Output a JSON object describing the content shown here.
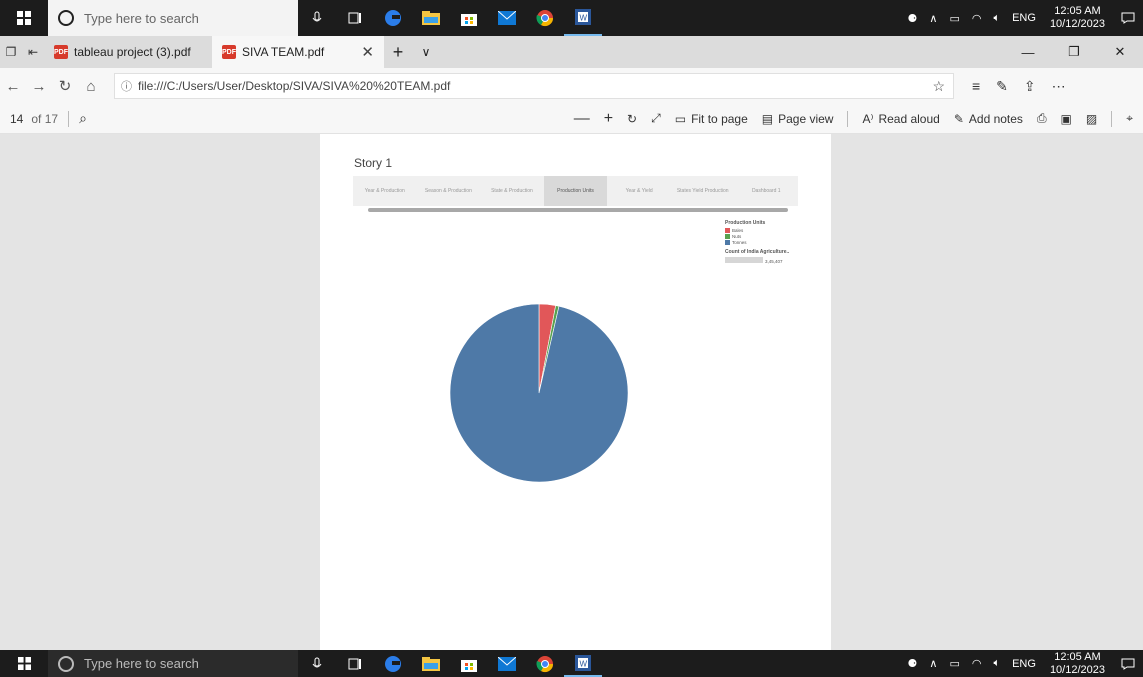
{
  "taskbar": {
    "search_placeholder": "Type here to search",
    "lang": "ENG",
    "time": "12:05 AM",
    "date": "10/12/2023"
  },
  "tabs": [
    {
      "label": "tableau project (3).pdf"
    },
    {
      "label": "SIVA TEAM.pdf"
    }
  ],
  "address": {
    "url": "file:///C:/Users/User/Desktop/SIVA/SIVA%20%20TEAM.pdf"
  },
  "pdf_toolbar": {
    "page_number": "14",
    "page_count": "of 17",
    "fit_to_page": "Fit to page",
    "page_view": "Page view",
    "read_aloud": "Read aloud",
    "add_notes": "Add notes"
  },
  "story": {
    "title": "Story 1",
    "nav_items": [
      "Year & Production",
      "Season & Production",
      "State & Production",
      "Production Units",
      "Year & Yield",
      "States Yield Production",
      "Dashboard 1"
    ],
    "active_index": 3
  },
  "legend": {
    "title": "Production Units",
    "items": [
      {
        "label": "Bales",
        "color": "#e15759"
      },
      {
        "label": "Nuts",
        "color": "#59a14f"
      },
      {
        "label": "Tonnes",
        "color": "#4e79a7"
      }
    ],
    "count_title": "Count of India Agriculture..",
    "count_value": "3,45,407"
  },
  "chart_data": {
    "type": "pie",
    "categories": [
      "Bales",
      "Nuts",
      "Tonnes"
    ],
    "values": [
      3.0,
      0.6,
      96.4
    ],
    "colors": [
      "#e15759",
      "#59a14f",
      "#4e79a7"
    ]
  }
}
